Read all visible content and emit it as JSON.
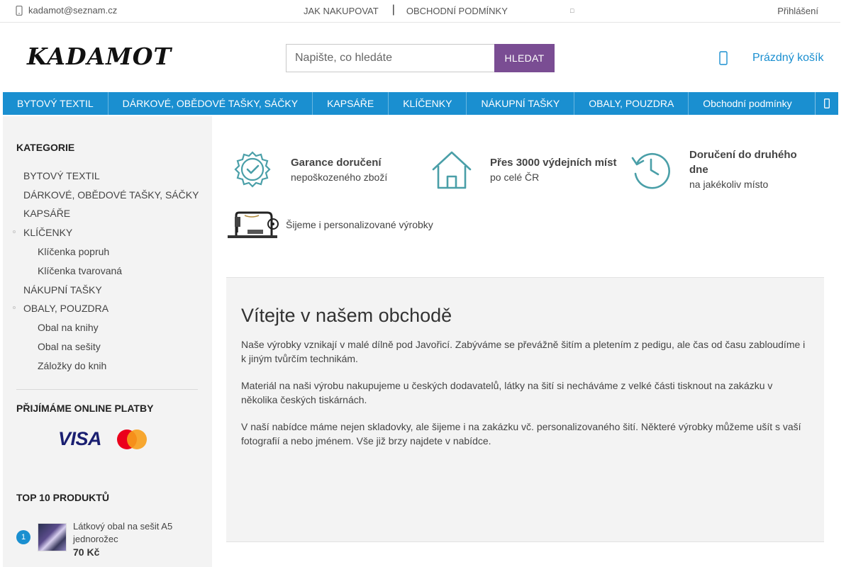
{
  "topbar": {
    "email": "kadamot@seznam.cz",
    "link_how_to_buy": "JAK NAKUPOVAT",
    "link_terms": "OBCHODNÍ PODMÍNKY",
    "login": "Přihlášení"
  },
  "header": {
    "logo": "KADAMOT",
    "search_placeholder": "Napište, co hledáte",
    "search_button": "HLEDAT",
    "cart_label": "Prázdný košík"
  },
  "nav": {
    "items": [
      "BYTOVÝ TEXTIL",
      "DÁRKOVÉ, OBĚDOVÉ TAŠKY, SÁČKY",
      "KAPSÁŘE",
      "KLÍČENKY",
      "NÁKUPNÍ TAŠKY",
      "OBALY, POUZDRA",
      "Obchodní podmínky"
    ]
  },
  "sidebar": {
    "categories_title": "KATEGORIE",
    "categories": [
      {
        "label": "BYTOVÝ TEXTIL"
      },
      {
        "label": "DÁRKOVÉ, OBĚDOVÉ TAŠKY, SÁČKY"
      },
      {
        "label": "KAPSÁŘE"
      },
      {
        "label": "KLÍČENKY"
      },
      {
        "label": "Klíčenka popruh"
      },
      {
        "label": "Klíčenka tvarovaná"
      },
      {
        "label": "NÁKUPNÍ TAŠKY"
      },
      {
        "label": "OBALY, POUZDRA"
      },
      {
        "label": "Obal na knihy"
      },
      {
        "label": "Obal na sešity"
      },
      {
        "label": "Záložky do knih"
      }
    ],
    "payments_title": "PŘIJÍMÁME ONLINE PLATBY",
    "visa": "VISA",
    "top_title": "TOP 10 PRODUKTŮ",
    "top_products": [
      {
        "rank": "1",
        "name": "Látkový obal na sešit A5 jednorožec",
        "price": "70 Kč"
      }
    ]
  },
  "benefits": [
    {
      "title": "Garance doručení",
      "subtitle": "nepoškozeného zboží",
      "icon": "badge-check-icon"
    },
    {
      "title": "Přes 3000 výdejních míst",
      "subtitle": "po celé ČR",
      "icon": "house-icon"
    },
    {
      "title": "Doručení do druhého dne",
      "subtitle": "na jakékoliv místo",
      "icon": "clock-history-icon"
    },
    {
      "title": "",
      "subtitle": "Šijeme i personalizované výrobky",
      "icon": "sewing-machine-icon"
    }
  ],
  "welcome": {
    "title": "Vítejte v našem obchodě",
    "p1": "Naše výrobky vznikají v malé dílně pod Javořicí. Zabýváme se převážně šitím a pletením z pedigu, ale čas od času zabloudíme i k jiným tvůrčím technikám.",
    "p2": "Materiál na naši výrobu nakupujeme u českých dodavatelů, látky na šití si necháváme z velké části tisknout na zakázku v několika českých tiskárnách.",
    "p3": "V naší nabídce máme nejen skladovky, ale šijeme i na zakázku vč. personalizovaného šití. Některé výrobky můžeme ušít s vaší fotografií a nebo jménem. Vše již brzy najdete v nabídce."
  },
  "colors": {
    "accent": "#1a8fd0",
    "search_button": "#7a4d93",
    "icon_teal": "#4a9fa8"
  }
}
